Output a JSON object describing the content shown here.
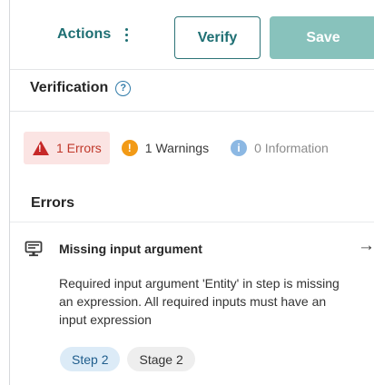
{
  "header": {
    "actions_label": "Actions",
    "verify_label": "Verify",
    "save_label": "Save"
  },
  "verification": {
    "title": "Verification",
    "help_glyph": "?"
  },
  "filters": [
    {
      "label": "1 Errors",
      "icon": "error-triangle-icon",
      "color": "#c62828"
    },
    {
      "label": "1 Warnings",
      "icon": "warning-circle-icon",
      "color": "#f29a16"
    },
    {
      "label": "0 Information",
      "icon": "info-circle-icon",
      "color": "#8cb8e3"
    }
  ],
  "errors": {
    "title": "Errors",
    "items": [
      {
        "icon": "monitor-icon",
        "title": "Missing input argument",
        "description": "Required input argument 'Entity' in step is missing an expression. All required inputs must have an input expression",
        "tags": [
          "Step 2",
          "Stage 2"
        ],
        "arrow": "→"
      }
    ]
  },
  "colors": {
    "accent": "#1e6f73",
    "save_disabled": "#88c2bc",
    "error_bg": "#fbe4e3"
  }
}
